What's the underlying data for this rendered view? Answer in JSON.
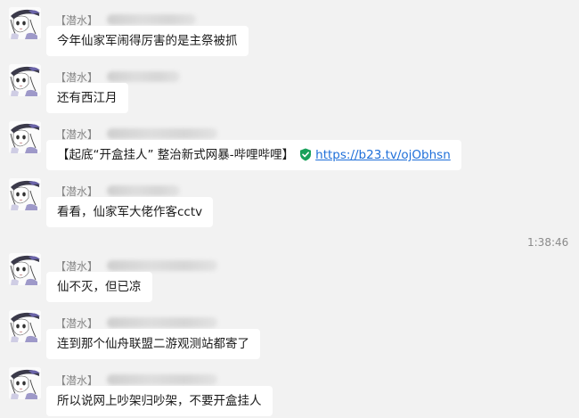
{
  "messages": [
    {
      "tag": "【潜水】",
      "text": "今年仙家军闹得厉害的是主祭被抓"
    },
    {
      "tag": "【潜水】",
      "text": "还有西江月"
    },
    {
      "tag": "【潜水】",
      "text": "【起底“开盒挂人” 整治新式网暴-哔哩哔哩】",
      "link": "https://b23.tv/ojObhsn"
    },
    {
      "tag": "【潜水】",
      "text": "看看，仙家军大佬作客cctv"
    },
    {
      "tag": "【潜水】",
      "text": "仙不灭，但已凉"
    },
    {
      "tag": "【潜水】",
      "text": "连到那个仙舟联盟二游观测站都寄了"
    },
    {
      "tag": "【潜水】",
      "text": "所以说网上吵架归吵架，不要开盒挂人"
    }
  ],
  "timestamp": "1:38:46",
  "icons": {
    "avatar": "anime-avatar-icon",
    "link_badge": "verified-shield-icon"
  },
  "colors": {
    "background": "#f2f2f2",
    "bubble": "#ffffff",
    "link": "#1e6fd9",
    "shield": "#18a05a"
  }
}
